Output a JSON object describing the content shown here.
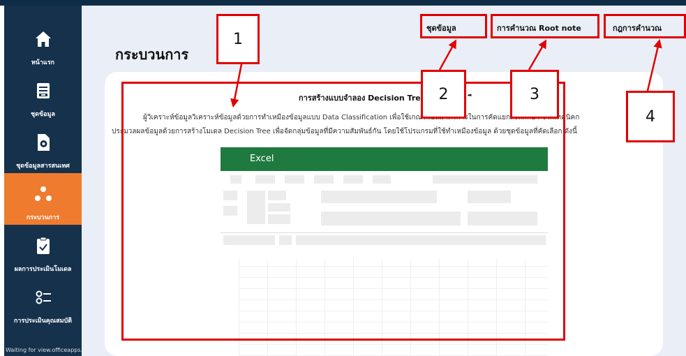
{
  "sidebar": {
    "items": [
      {
        "label": "หน้าแรก",
        "icon": "home-icon",
        "active": false
      },
      {
        "label": "ชุดข้อมูล",
        "icon": "dataset-icon",
        "active": false
      },
      {
        "label": "ชุดข้อมูลสารสนเทศ",
        "icon": "info-file-icon",
        "active": false
      },
      {
        "label": "กระบวนการ",
        "icon": "process-icon",
        "active": true
      },
      {
        "label": "ผลการประเมินโมเดล",
        "icon": "clipboard-check-icon",
        "active": false
      },
      {
        "label": "การประเมินคุณสมบัติ",
        "icon": "settings-list-icon",
        "active": false
      }
    ],
    "status_text": "Waiting for view.officeapps..."
  },
  "header": {
    "page_title": "กระบวนการ",
    "links": {
      "dataset": "ชุดข้อมูล",
      "root_note": "การคำนวณ Root note",
      "rules": "กฎการคำนวณ"
    }
  },
  "content": {
    "title": "การสร้างแบบจำลอง Decision Tree",
    "title_suffix": "ี",
    "line1": "ผู้วิเคราะห์ข้อมูลวิเคราะห์ข้อมูลด้วยการทำเหมืองข้อมูลแบบ  Data  Classification  เพื่อใช้เกณฑ์เป็นมาตรการในการคัดแยกสิ่งที่ศึกษา  จากเทคนิคก",
    "line2": "ประมวลผลข้อมูลด้วยการสร้างโมเดล Decision Tree เพื่อจัดกลุ่มข้อมูลที่มีความสัมพันธ์กัน โดยใช้โปรแกรมที่ใช้ทำเหมืองข้อมูล ด้วยชุดข้อมูลที่คัดเลือก ดังนี้"
  },
  "excel": {
    "title": "Excel"
  },
  "callouts": [
    "1",
    "2",
    "3",
    "4"
  ],
  "colors": {
    "sidebar": "#15314b",
    "active": "#ef7b2f",
    "annotation": "#e00000",
    "excel": "#1f7a3f",
    "main_bg": "#e9eef7"
  }
}
